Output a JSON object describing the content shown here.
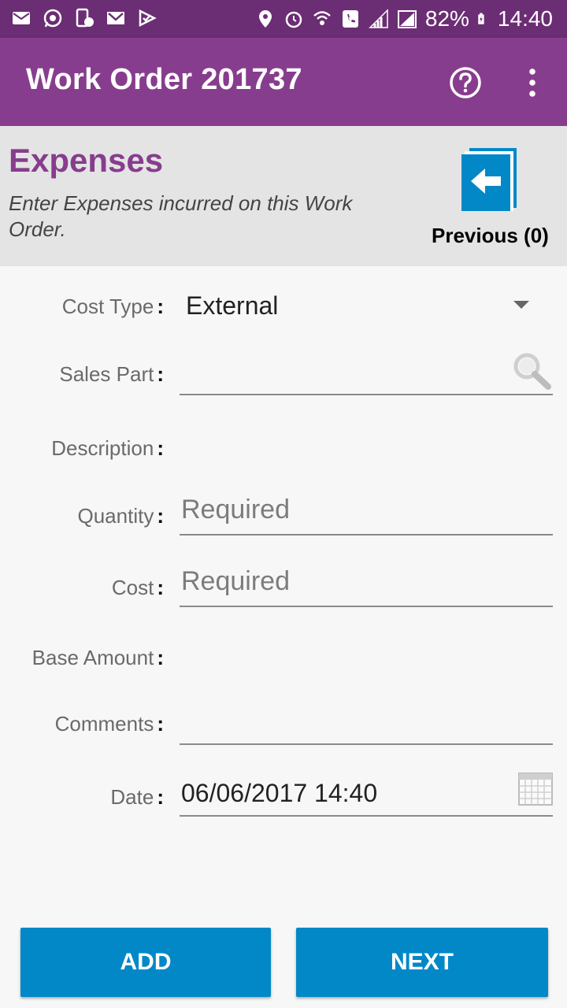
{
  "status_bar": {
    "battery": "82%",
    "time": "14:40"
  },
  "toolbar": {
    "title": "Work Order 201737",
    "help_icon": "help-circle-icon",
    "more_icon": "more-vertical-icon"
  },
  "header": {
    "title": "Expenses",
    "subtitle": "Enter Expenses incurred on this Work Order.",
    "previous_label": "Previous (0)"
  },
  "form": {
    "cost_type": {
      "label": "Cost Type",
      "value": "External"
    },
    "sales_part": {
      "label": "Sales Part",
      "value": ""
    },
    "description": {
      "label": "Description",
      "value": ""
    },
    "quantity": {
      "label": "Quantity",
      "placeholder": "Required"
    },
    "cost": {
      "label": "Cost",
      "placeholder": "Required"
    },
    "base_amount": {
      "label": "Base Amount",
      "value": ""
    },
    "comments": {
      "label": "Comments",
      "value": ""
    },
    "date": {
      "label": "Date",
      "value": "06/06/2017 14:40"
    }
  },
  "buttons": {
    "add": "ADD",
    "next": "NEXT"
  },
  "colors": {
    "status_bar": "#6b2d73",
    "toolbar": "#873d8e",
    "accent_title": "#873d8e",
    "button": "#0288c7"
  }
}
